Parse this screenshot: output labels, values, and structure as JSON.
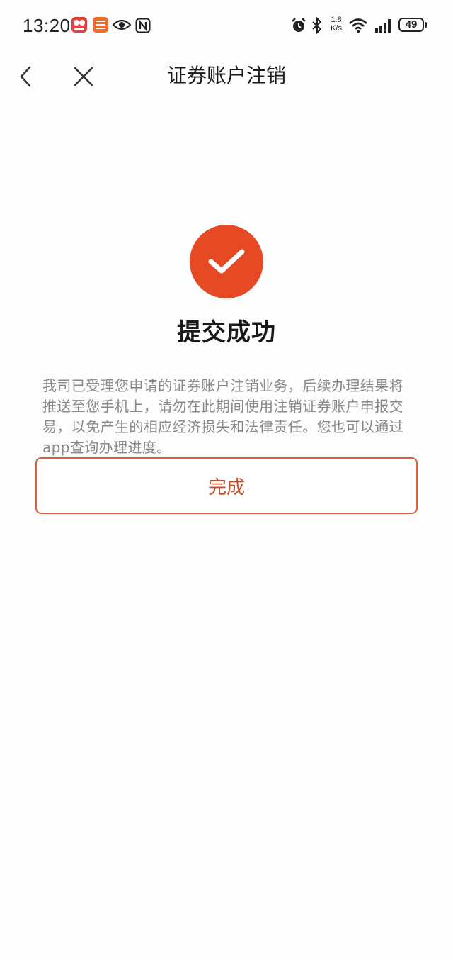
{
  "status_bar": {
    "time": "13:20",
    "net_speed_value": "1.8",
    "net_speed_unit": "K/s",
    "battery_level": "49",
    "icons": [
      "tmall-618-app-icon",
      "pingan-securities-app-icon",
      "eye-icon",
      "nfc-icon",
      "alarm-icon",
      "bluetooth-icon",
      "wifi-icon",
      "signal-icon",
      "battery-icon"
    ]
  },
  "nav": {
    "title": "证券账户注销",
    "back_icon": "chevron-left-icon",
    "close_icon": "close-icon"
  },
  "result": {
    "icon": "check-circle-icon",
    "title": "提交成功",
    "description": "我司已受理您申请的证券账户注销业务，后续办理结果将推送至您手机上，请勿在此期间使用注销证券账户申报交易，以免产生的相应经济损失和法律责任。您也可以通过app查询办理进度。",
    "button_label": "完成"
  },
  "colors": {
    "accent": "#e64a24",
    "button_text": "#cc4b25",
    "button_border": "#d9603a",
    "description_text": "#888888",
    "background": "#fdfdfd"
  }
}
